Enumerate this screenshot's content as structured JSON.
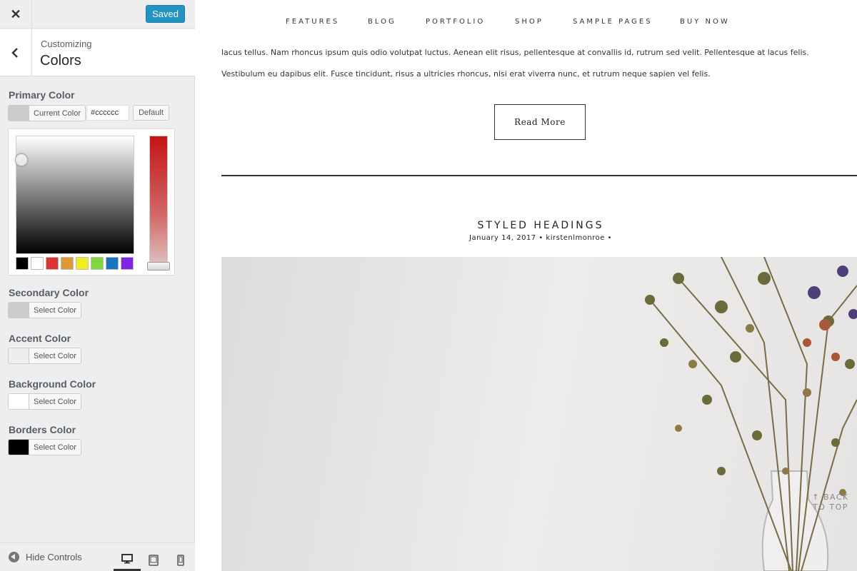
{
  "customizer": {
    "saved_label": "Saved",
    "breadcrumb": "Customizing",
    "section_title": "Colors",
    "controls": {
      "primary": {
        "label": "Primary Color",
        "button": "Current Color",
        "hex_value": "#cccccc",
        "default_label": "Default",
        "swatch_color": "#cccccc"
      },
      "secondary": {
        "label": "Secondary Color",
        "button": "Select Color",
        "swatch_color": "#cccccc"
      },
      "accent": {
        "label": "Accent Color",
        "button": "Select Color",
        "swatch_color": "#eeeeee"
      },
      "background": {
        "label": "Background Color",
        "button": "Select Color",
        "swatch_color": "#ffffff"
      },
      "borders": {
        "label": "Borders Color",
        "button": "Select Color",
        "swatch_color": "#000000"
      }
    },
    "palette": [
      "#000000",
      "#ffffff",
      "#dd3333",
      "#dd9933",
      "#eeee22",
      "#81d742",
      "#1e73be",
      "#8224e3"
    ],
    "hide_controls_label": "Hide Controls",
    "devices": [
      "desktop-icon",
      "tablet-icon",
      "mobile-icon"
    ]
  },
  "preview": {
    "nav": [
      "FEATURES",
      "BLOG",
      "PORTFOLIO",
      "SHOP",
      "SAMPLE PAGES",
      "BUY NOW"
    ],
    "paragraphs": [
      "lacus tellus. Nam rhoncus ipsum quis odio volutpat luctus. Aenean elit risus, pellentesque at convallis id, rutrum sed velit. Pellentesque at lacus felis.",
      "Vestibulum eu dapibus elit. Fusce tincidunt, risus a ultricies rhoncus, nisi erat viverra nunc, et rutrum neque sapien vel felis."
    ],
    "read_more": "Read More",
    "post_title": "STYLED HEADINGS",
    "post_meta": "January 14, 2017 • kirstenlmonroe •",
    "back_to_top": "↑ BACK TO TOP"
  }
}
